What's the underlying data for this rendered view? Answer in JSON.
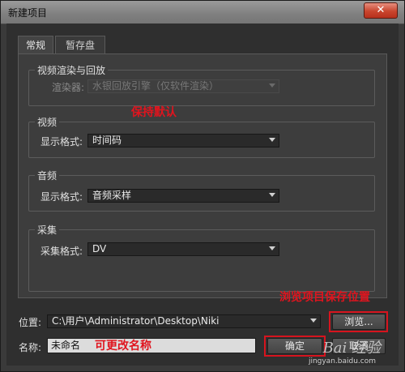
{
  "window": {
    "title": "新建项目",
    "close_glyph": "✕"
  },
  "tabs": [
    {
      "label": "常规"
    },
    {
      "label": "暂存盘"
    }
  ],
  "playback": {
    "legend": "视频渲染与回放",
    "renderer_label": "渲染器:",
    "renderer_value": "水银回放引擎（仅软件渲染）"
  },
  "video": {
    "legend": "视频",
    "display_label": "显示格式:",
    "display_value": "时间码"
  },
  "audio": {
    "legend": "音频",
    "display_label": "显示格式:",
    "display_value": "音频采样"
  },
  "capture": {
    "legend": "采集",
    "format_label": "采集格式:",
    "format_value": "DV"
  },
  "location": {
    "label": "位置:",
    "value": "C:\\用户\\Administrator\\Desktop\\Niki",
    "browse_label": "浏览..."
  },
  "name": {
    "label": "名称:",
    "value": "未命名"
  },
  "buttons": {
    "ok_label": "确定",
    "cancel_label": "取消"
  },
  "annotations": {
    "keep_default": "保持默认",
    "browse_note": "浏览项目保存位置",
    "rename_note": "可更改名称"
  },
  "watermark": {
    "logo": "Bai 经验",
    "url": "jingyan.baidu.com"
  },
  "colors": {
    "annotation_red": "#e0141e",
    "dialog_bg": "#3d3d3d"
  }
}
